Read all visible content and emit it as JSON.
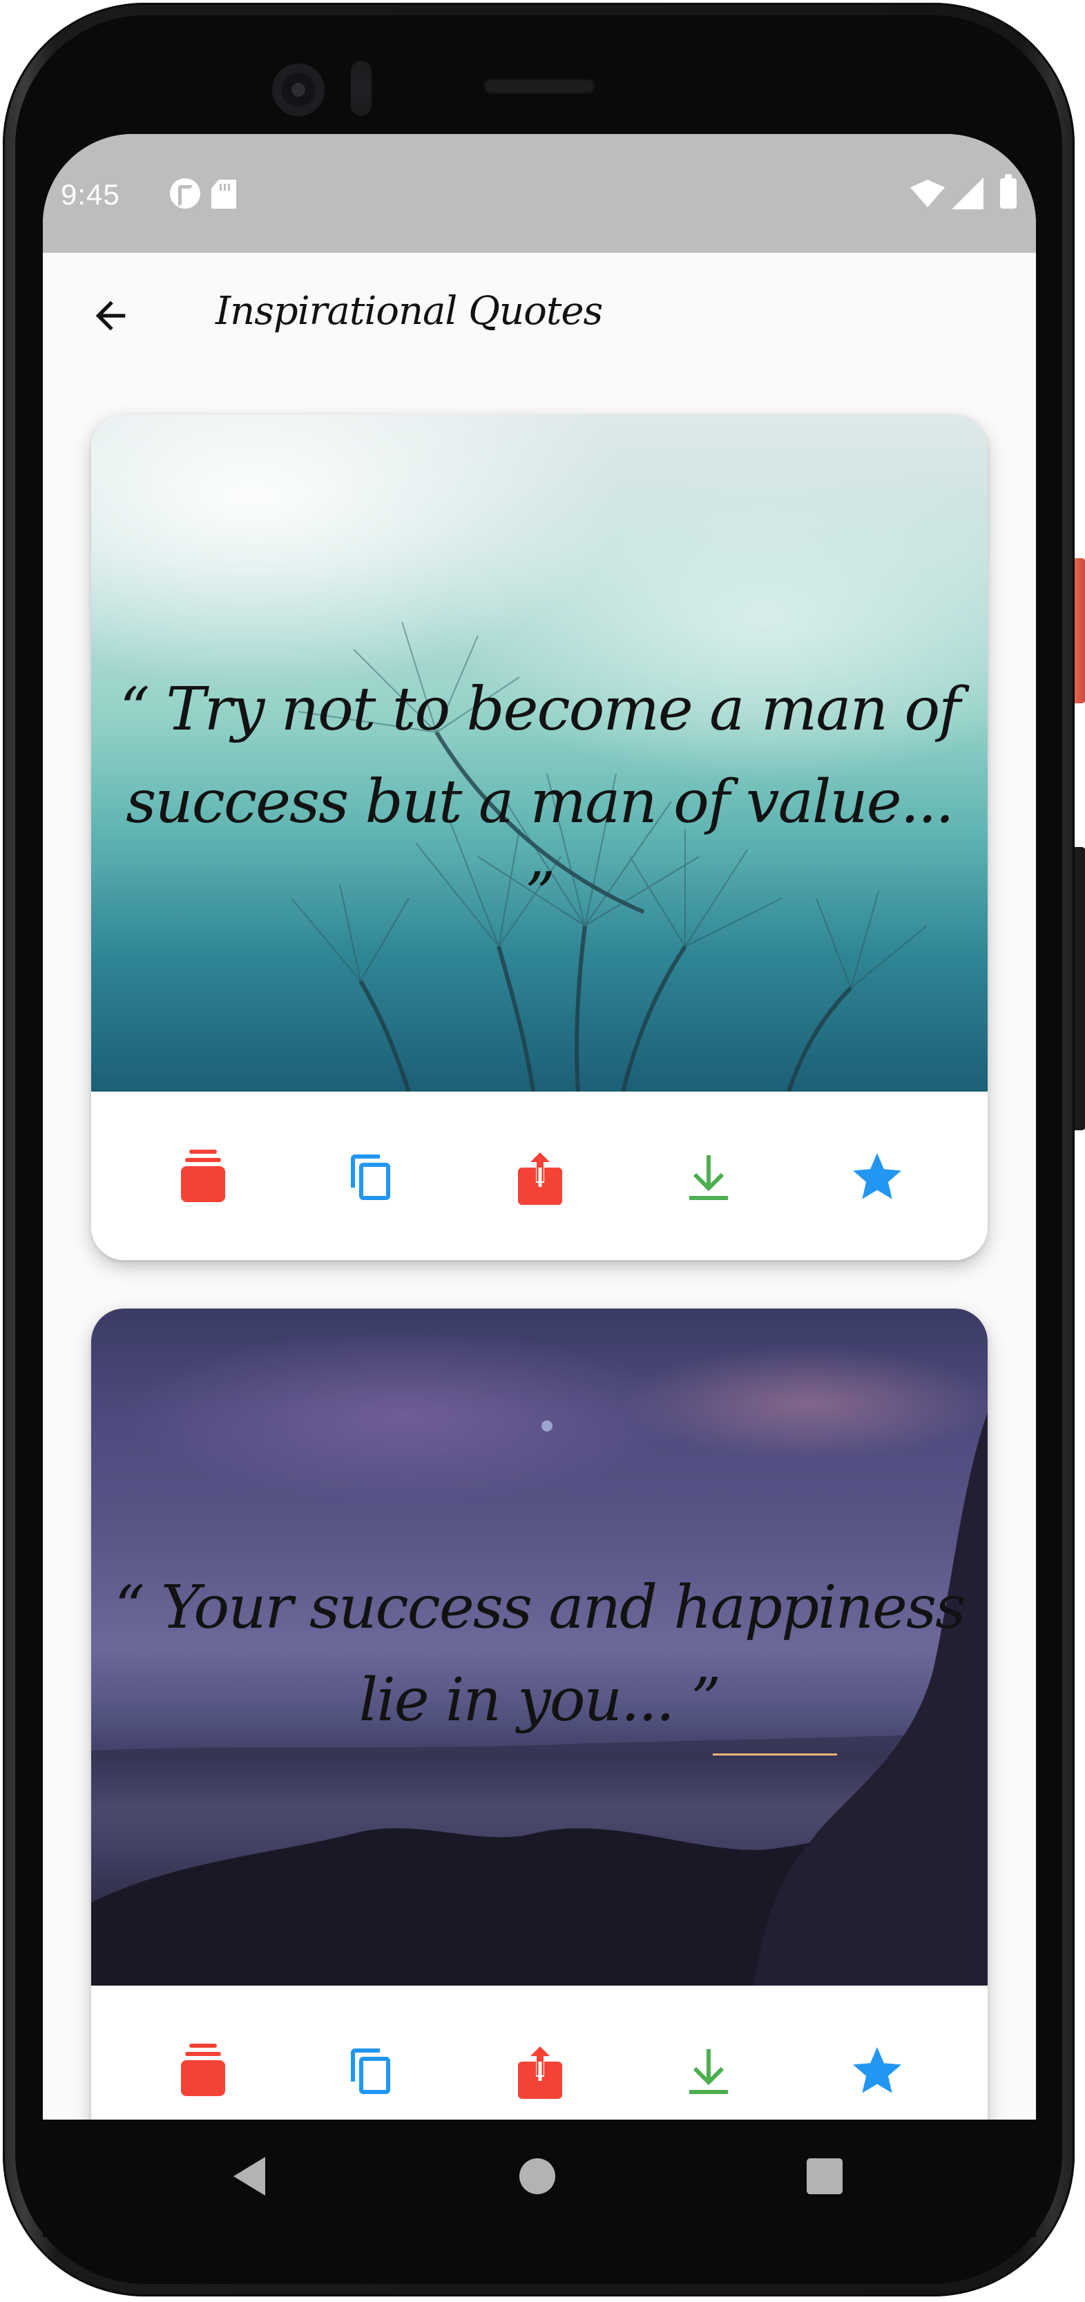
{
  "status_bar": {
    "time": "9:45",
    "icons": [
      "app-notification-icon",
      "sd-card-icon",
      "wifi-icon",
      "signal-icon",
      "battery-icon"
    ]
  },
  "app_bar": {
    "back_icon": "arrow-back-icon",
    "title": "Inspirational Quotes"
  },
  "quotes": [
    {
      "text": "“ Try not to become a man of success but a man of value... ”",
      "background": "dandelion-teal",
      "actions": [
        {
          "icon": "layers-icon",
          "color": "#f44336"
        },
        {
          "icon": "copy-icon",
          "color": "#2196f3"
        },
        {
          "icon": "share-icon",
          "color": "#f44336"
        },
        {
          "icon": "download-icon",
          "color": "#4caf50"
        },
        {
          "icon": "star-icon",
          "color": "#2196f3"
        }
      ]
    },
    {
      "text": "“ Your success and happiness lie in you... ”",
      "background": "dusk-sea-purple",
      "actions": [
        {
          "icon": "layers-icon",
          "color": "#f44336"
        },
        {
          "icon": "copy-icon",
          "color": "#2196f3"
        },
        {
          "icon": "share-icon",
          "color": "#f44336"
        },
        {
          "icon": "download-icon",
          "color": "#4caf50"
        },
        {
          "icon": "star-icon",
          "color": "#2196f3"
        }
      ]
    }
  ],
  "nav_bar": {
    "buttons": [
      "nav-back-icon",
      "nav-home-icon",
      "nav-recents-icon"
    ]
  }
}
